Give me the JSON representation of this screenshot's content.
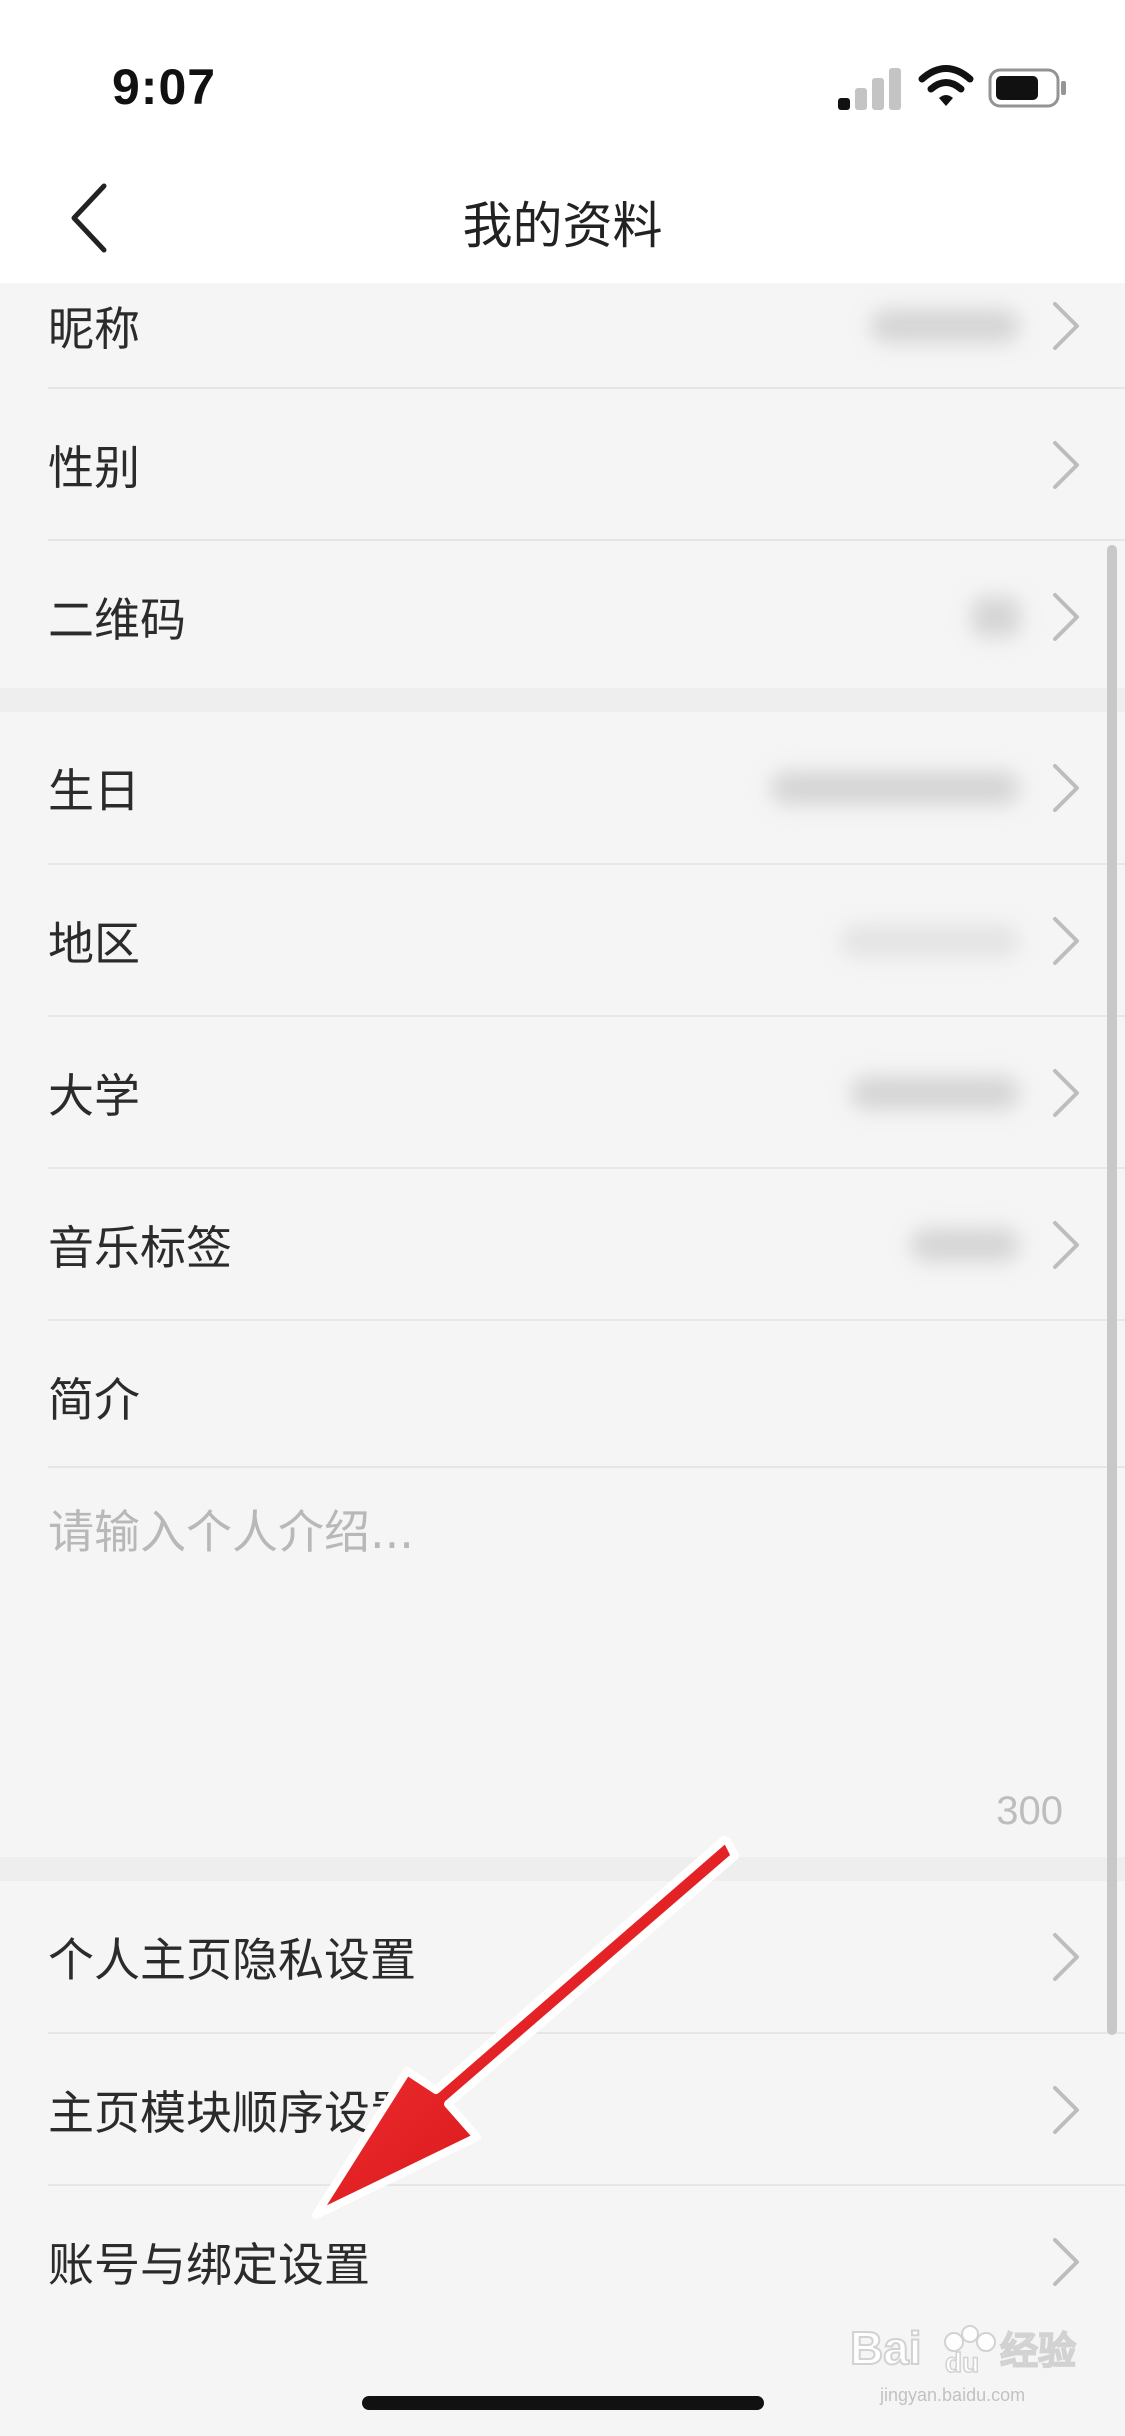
{
  "status_bar": {
    "time": "9:07",
    "signal_icon": "cellular-signal-icon",
    "wifi_icon": "wifi-icon",
    "battery_icon": "battery-icon"
  },
  "nav": {
    "title": "我的资料",
    "back_icon": "chevron-left-icon"
  },
  "profile_rows": [
    {
      "label": "昵称"
    },
    {
      "label": "性别"
    },
    {
      "label": "二维码"
    },
    {
      "label": "生日"
    },
    {
      "label": "地区"
    },
    {
      "label": "大学"
    },
    {
      "label": "音乐标签"
    },
    {
      "label": "简介"
    }
  ],
  "intro": {
    "placeholder": "请输入个人介绍...",
    "char_limit": "300"
  },
  "settings_rows": [
    {
      "label": "个人主页隐私设置"
    },
    {
      "label": "主页模块顺序设置"
    },
    {
      "label": "账号与绑定设置"
    }
  ],
  "annotation": {
    "arrow_color": "#e8141b"
  },
  "watermark": {
    "brand": "Bai",
    "brand_suffix": "du",
    "sub": "经验",
    "url": "jingyan.baidu.com"
  },
  "colors": {
    "background": "#f5f5f5",
    "header": "#ffffff",
    "text": "#2b2b2b",
    "placeholder": "#b8b8b8",
    "chevron": "#bdbdbd"
  }
}
